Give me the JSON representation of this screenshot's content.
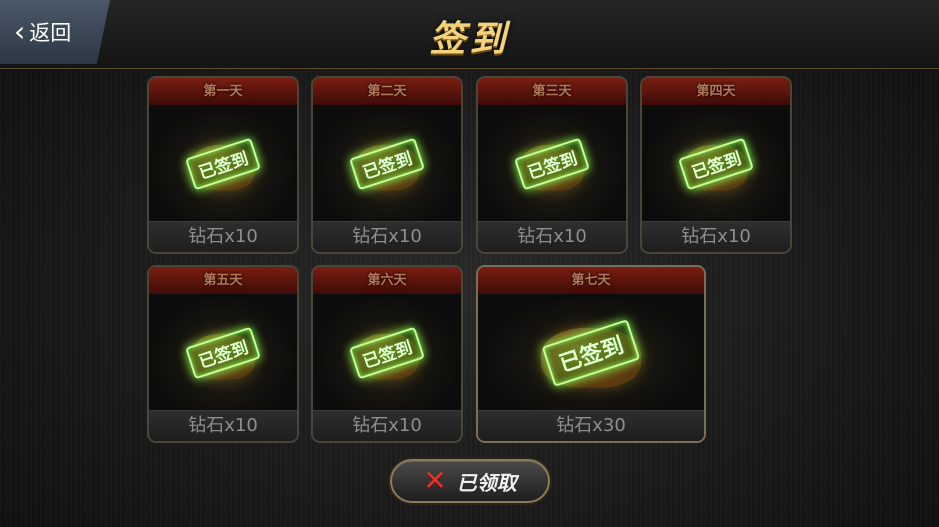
{
  "header": {
    "back_label": "返回",
    "title": "签到"
  },
  "days": [
    {
      "day_label": "第一天",
      "status": "已签到",
      "reward": "钻石x10"
    },
    {
      "day_label": "第二天",
      "status": "已签到",
      "reward": "钻石x10"
    },
    {
      "day_label": "第三天",
      "status": "已签到",
      "reward": "钻石x10"
    },
    {
      "day_label": "第四天",
      "status": "已签到",
      "reward": "钻石x10"
    },
    {
      "day_label": "第五天",
      "status": "已签到",
      "reward": "钻石x10"
    },
    {
      "day_label": "第六天",
      "status": "已签到",
      "reward": "钻石x10"
    },
    {
      "day_label": "第七天",
      "status": "已签到",
      "reward": "钻石x30"
    }
  ],
  "footer": {
    "claim_label": "已领取",
    "claim_icon": "close-x-icon"
  },
  "colors": {
    "title": "#f2d27a",
    "stamp_glow": "#7cff4a",
    "day_header": "#7a1e12",
    "claim_icon": "#e0322a"
  }
}
